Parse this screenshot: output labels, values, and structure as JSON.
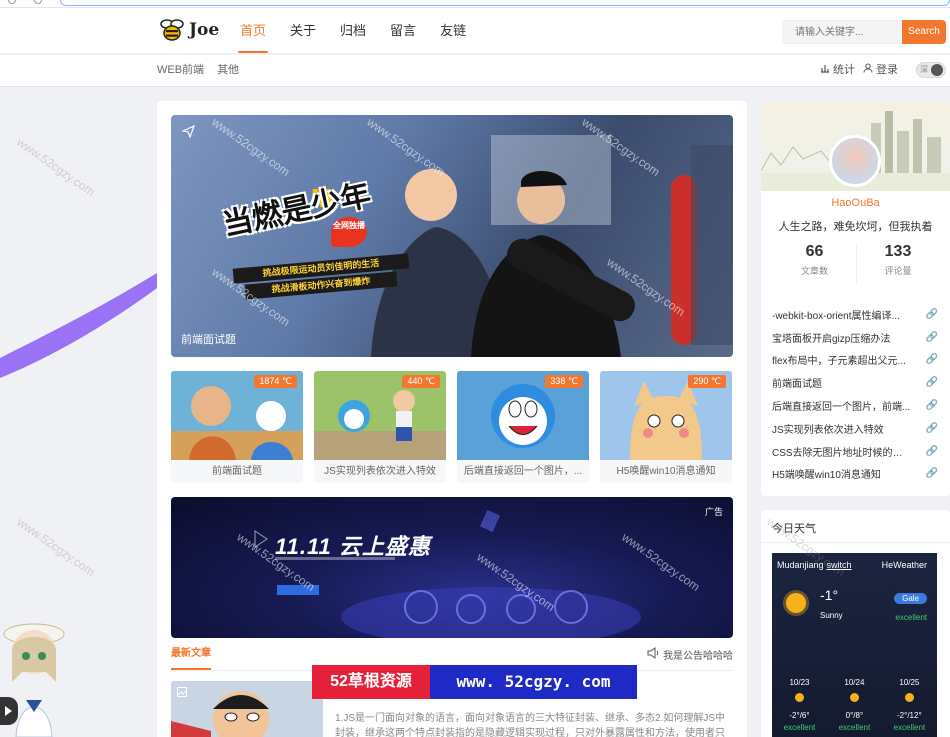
{
  "header": {
    "logo_text": "Joe",
    "nav": [
      "首页",
      "关于",
      "归档",
      "留言",
      "友链"
    ],
    "search_placeholder": "请输入关键字...",
    "search_button": "Search"
  },
  "subbar": {
    "links": [
      "WEB前端",
      "其他"
    ],
    "stats_label": "统计",
    "login_label": "登录",
    "toggle_label": "深"
  },
  "hero": {
    "caption": "前端面试题",
    "title": "当燃是少年",
    "badge": "全网独播",
    "strip1": "挑战极限运动员刘佳明的生活",
    "strip2": "挑战滑板动作兴奋到爆炸"
  },
  "thumbs": [
    {
      "temp": "1874 ℃",
      "label": "前端面试题",
      "bg": "#6fb2d8"
    },
    {
      "temp": "440 ℃",
      "label": "JS实现列表依次进入特效",
      "bg": "#9cc36a"
    },
    {
      "temp": "338 ℃",
      "label": "后端直接返回一个图片，...",
      "bg": "#5aa1d8"
    },
    {
      "temp": "290 ℃",
      "label": "H5唤醒win10消息通知",
      "bg": "#9fc6ea"
    }
  ],
  "ad": {
    "title": "11.11 云上盛惠",
    "tag": "广告"
  },
  "feed": {
    "tab_label": "最新文章",
    "notice": "我是公告哈哈哈",
    "article_excerpt": "1.JS是一门面向对象的语言，面向对象语言的三大特征封装、继承、多态2.如何理解JS中封装，继承这两个特点封装指的是隐藏逻辑实现过程，只对外暴露属性和方法，使用者只需要"
  },
  "watermark": {
    "left": "52草根资源",
    "right": "www. 52cgzy. com",
    "diag": "www.52cgzy.com"
  },
  "profile": {
    "name": "HaoOuBa",
    "motto": "人生之路，难免坎坷，但我执着",
    "articles_count": "66",
    "articles_label": "文章数",
    "comments_count": "133",
    "comments_label": "评论量",
    "posts": [
      "-webkit-box-orient属性编译...",
      "宝塔面板开启gizp压缩办法",
      "flex布局中，子元素超出父元...",
      "前端面试题",
      "后端直接返回一个图片，前端...",
      "JS实现列表依次进入特效",
      "CSS去除无图片地址时候的边框",
      "H5端唤醒win10消息通知"
    ]
  },
  "weather": {
    "title": "今日天气",
    "city": "Mudanjiang",
    "switch": "switch",
    "source": "HeWeather",
    "temp": "-1°",
    "desc": "Sunny",
    "wind": "Gale",
    "aqi": "excellent",
    "days": [
      {
        "date": "10/23",
        "range": "-2°/6°",
        "aqi": "excellent"
      },
      {
        "date": "10/24",
        "range": "0°/8°",
        "aqi": "excellent"
      },
      {
        "date": "10/25",
        "range": "-2°/12°",
        "aqi": "excellent"
      }
    ]
  },
  "colors": {
    "accent": "#f4772f",
    "page_bg": "#f0f1f4"
  }
}
